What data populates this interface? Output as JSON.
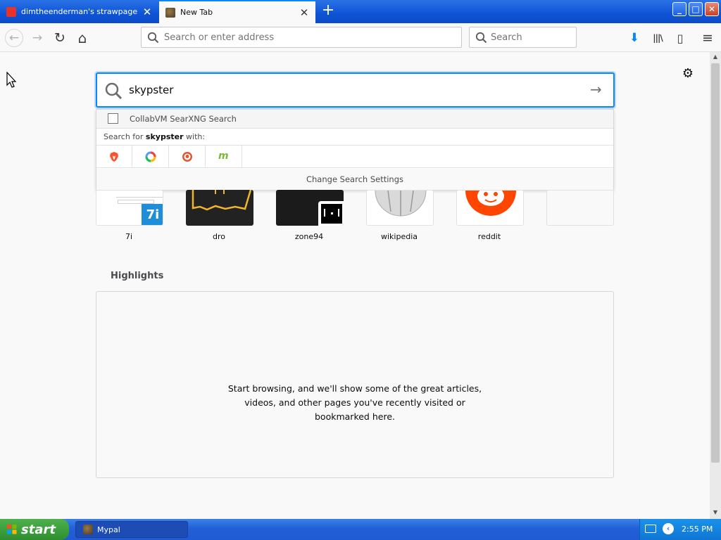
{
  "tabs": [
    {
      "title": "dimtheenderman's strawpage",
      "active": false,
      "close": "✕"
    },
    {
      "title": "New Tab",
      "active": true,
      "close": "✕"
    }
  ],
  "new_tab_symbol": "+",
  "window_controls": {
    "minimize": "_",
    "maximize": "□",
    "close": "✕"
  },
  "toolbar": {
    "back_icon": "←",
    "forward_icon": "→",
    "reload_icon": "↻",
    "home_icon": "⌂",
    "url_placeholder": "Search or enter address",
    "search_placeholder": "Search",
    "download_icon": "⬇",
    "library_icon": "|||\\",
    "sidebar_icon": "▯",
    "menu_icon": "≡"
  },
  "newtab": {
    "settings_icon": "⚙",
    "search": {
      "query": "skypster",
      "go_icon": "→",
      "suggestion": "CollabVM SearXNG Search",
      "search_for_prefix": "Search for ",
      "search_for_query": "skypster",
      "search_for_suffix": " with:",
      "engine_icons": [
        "brave-icon",
        "qwant-icon",
        "duckduckgo-icon",
        "mojeek-icon"
      ],
      "change_settings": "Change Search Settings"
    },
    "top_sites": [
      {
        "label": "7i",
        "badge": "7i"
      },
      {
        "label": "dro"
      },
      {
        "label": "zone94"
      },
      {
        "label": "wikipedia"
      },
      {
        "label": "reddit"
      },
      {
        "label": ""
      }
    ],
    "highlights": {
      "title": "Highlights",
      "line1": "Start browsing, and we'll show some of the great articles,",
      "line2": "videos, and other pages you've recently visited or",
      "line3": "bookmarked here."
    }
  },
  "taskbar": {
    "start_label": "start",
    "window_label": "Mypal",
    "clock": "2:55 PM"
  },
  "colors": {
    "accent": "#0a84ff",
    "title_bar": "#0e53d6",
    "start_green": "#3a9a3a",
    "reddit": "#ff4500"
  }
}
